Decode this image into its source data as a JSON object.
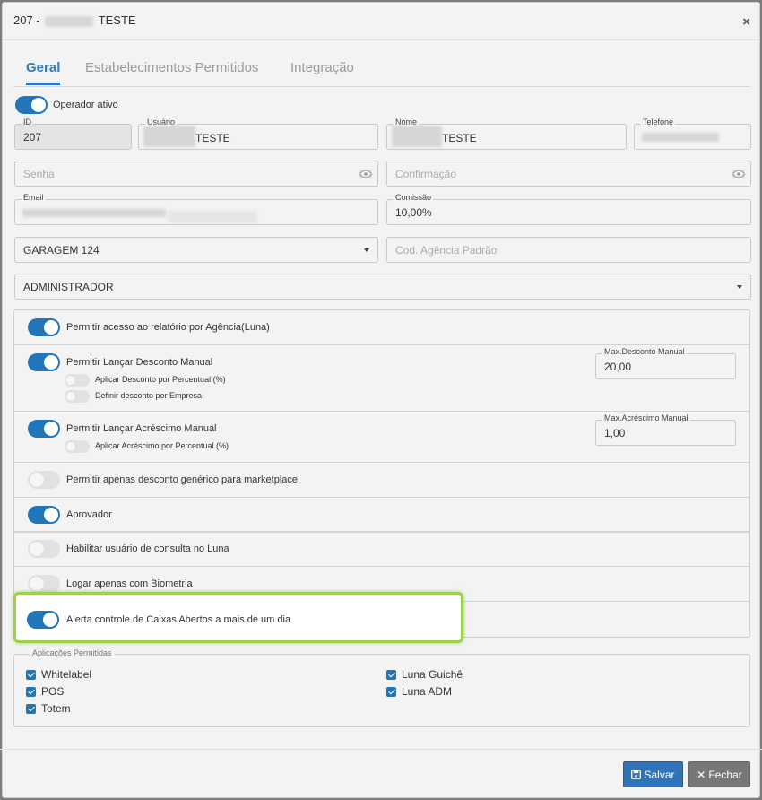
{
  "header": {
    "title_prefix": "207 -",
    "title_suffix": "TESTE",
    "close_glyph": "×"
  },
  "tabs": [
    {
      "label": "Geral",
      "active": true
    },
    {
      "label": "Estabelecimentos Permitidos",
      "active": false
    },
    {
      "label": "Integração",
      "active": false
    }
  ],
  "operator_active": {
    "label": "Operador ativo",
    "on": true
  },
  "fields": {
    "id": {
      "label": "ID",
      "value": "207"
    },
    "usuario": {
      "label": "Usuário",
      "value_suffix": "TESTE"
    },
    "nome": {
      "label": "Nome",
      "value_suffix": "TESTE"
    },
    "telefone": {
      "label": "Telefone"
    },
    "senha": {
      "placeholder": "Senha"
    },
    "confirmacao": {
      "placeholder": "Confirmação"
    },
    "email": {
      "label": "Email"
    },
    "comissao": {
      "label": "Comissão",
      "value": "10,00%"
    },
    "garagem": {
      "value": "GARAGEM 124"
    },
    "cod_agencia": {
      "placeholder": "Cod. Agência Padrão"
    },
    "perfil": {
      "value": "ADMINISTRADOR"
    }
  },
  "permissions": {
    "relatorio_agencia": {
      "label": "Permitir acesso ao relatório por Agência(Luna)",
      "on": true
    },
    "desconto_manual": {
      "label": "Permitir Lançar Desconto Manual",
      "on": true
    },
    "desconto_percentual": {
      "label": "Aplicar Desconto por Percentual (%)",
      "on": false
    },
    "desconto_empresa": {
      "label": "Definir desconto por Empresa",
      "on": false
    },
    "max_desconto": {
      "label": "Max.Desconto Manual",
      "value": "20,00"
    },
    "acrescimo_manual": {
      "label": "Permitir Lançar Acréscimo Manual",
      "on": true
    },
    "acrescimo_percentual": {
      "label": "Aplicar Acréscimo por Percentual (%)",
      "on": false
    },
    "max_acrescimo": {
      "label": "Max.Acréscimo Manual",
      "value": "1,00"
    },
    "desconto_marketplace": {
      "label": "Permitir apenas desconto genérico para marketplace",
      "on": false
    },
    "aprovador": {
      "label": "Aprovador",
      "on": true
    },
    "consulta_luna": {
      "label": "Habilitar usuário de consulta no Luna",
      "on": false
    },
    "biometria": {
      "label": "Logar apenas com Biometria",
      "on": false
    },
    "alerta_caixas": {
      "label": "Alerta controle de Caixas Abertos a mais de um dia",
      "on": true
    }
  },
  "applications": {
    "legend": "Aplicações Permitidas",
    "items": [
      {
        "label": "Whitelabel",
        "checked": true
      },
      {
        "label": "POS",
        "checked": true
      },
      {
        "label": "Totem",
        "checked": true
      },
      {
        "label": "Luna Guichê",
        "checked": true
      },
      {
        "label": "Luna ADM",
        "checked": true
      }
    ]
  },
  "footer": {
    "save_label": "Salvar",
    "close_label": "Fechar"
  },
  "colors": {
    "accent": "#2375b9",
    "highlight": "#9bd14b"
  }
}
